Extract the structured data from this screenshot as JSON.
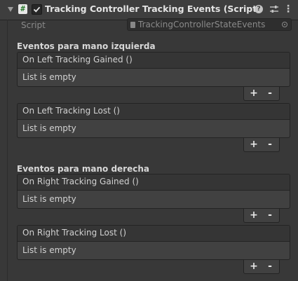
{
  "header": {
    "title": "Tracking Controller Tracking Events (Script)",
    "script_glyph": "#",
    "enabled": true,
    "help_glyph": "?",
    "menu_glyph": "⋮"
  },
  "script": {
    "label": "Script",
    "value": "TrackingControllerStateEvents"
  },
  "sections": {
    "left_title": "Eventos para mano izquierda",
    "right_title": "Eventos para mano derecha"
  },
  "events": [
    {
      "name": "On Left Tracking Gained ()",
      "empty_text": "List is empty"
    },
    {
      "name": "On Left Tracking Lost ()",
      "empty_text": "List is empty"
    },
    {
      "name": "On Right Tracking Gained ()",
      "empty_text": "List is empty"
    },
    {
      "name": "On Right Tracking Lost ()",
      "empty_text": "List is empty"
    }
  ],
  "buttons": {
    "plus": "+",
    "minus": "-"
  },
  "colors": {
    "background": "#383838",
    "header": "#3e3e3e",
    "box": "#414141",
    "text": "#d2d2d2"
  }
}
